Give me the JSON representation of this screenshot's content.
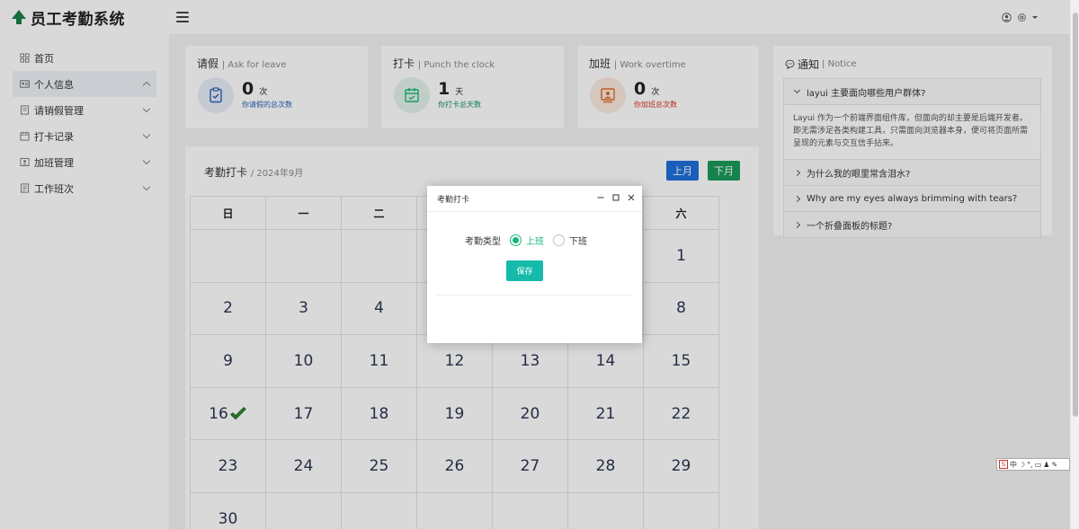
{
  "app": {
    "title": "员工考勤系统"
  },
  "header": {
    "user_icon": "user-icon",
    "settings_icon": "gear-icon"
  },
  "sidebar": {
    "items": [
      {
        "label": "首页",
        "icon": "grid-icon",
        "has_arrow": false
      },
      {
        "label": "个人信息",
        "icon": "id-card-icon",
        "has_arrow": true,
        "expanded": true
      },
      {
        "label": "请销假管理",
        "icon": "form-icon",
        "has_arrow": true
      },
      {
        "label": "打卡记录",
        "icon": "calendar-icon",
        "has_arrow": true
      },
      {
        "label": "加班管理",
        "icon": "monitor-icon",
        "has_arrow": true
      },
      {
        "label": "工作班次",
        "icon": "document-icon",
        "has_arrow": true
      }
    ]
  },
  "stats": [
    {
      "title": "请假",
      "subtitle": "| Ask for leave",
      "value": "0",
      "unit": "次",
      "desc": "你请假的总次数",
      "color": "#2d5fb3",
      "bg": "#e8edf7"
    },
    {
      "title": "打卡",
      "subtitle": "| Punch the clock",
      "value": "1",
      "unit": "天",
      "desc": "你打卡总天数",
      "color": "#16b777",
      "bg": "#e3f3ec"
    },
    {
      "title": "加班",
      "subtitle": "| Work overtime",
      "value": "0",
      "unit": "次",
      "desc": "你加班总次数",
      "color": "#e06a2f",
      "bg": "#fbeadf"
    }
  ],
  "calendar": {
    "title": "考勤打卡",
    "subtitle": "/ 2024年9月",
    "prev_label": "上月",
    "next_label": "下月",
    "weekdays": [
      "日",
      "一",
      "二",
      "三",
      "四",
      "五",
      "六"
    ],
    "weeks": [
      [
        "",
        "",
        "",
        "",
        "",
        "",
        "1"
      ],
      [
        "2",
        "3",
        "4",
        "5",
        "6",
        "7",
        "8"
      ],
      [
        "9",
        "10",
        "11",
        "12",
        "13",
        "14",
        "15"
      ],
      [
        "16",
        "17",
        "18",
        "19",
        "20",
        "21",
        "22"
      ],
      [
        "23",
        "24",
        "25",
        "26",
        "27",
        "28",
        "29"
      ],
      [
        "30",
        "",
        "",
        "",
        "",
        "",
        ""
      ]
    ],
    "checked_day": "16"
  },
  "notice": {
    "title": "通知",
    "subtitle": "| Notice",
    "items": [
      {
        "q": "layui 主要面向哪些用户群体?",
        "open": true,
        "a": "Layui 作为一个前端界面组件库，但面向的却主要是后端开发者。即无需涉足各类构建工具，只需面向浏览器本身，便可将页面所需呈现的元素与交互信手拈来。"
      },
      {
        "q": "为什么我的眼里常含泪水?",
        "open": false
      },
      {
        "q": "Why are my eyes always brimming with tears?",
        "open": false
      },
      {
        "q": "一个折叠面板的标题?",
        "open": false
      }
    ]
  },
  "modal": {
    "title": "考勤打卡",
    "field_label": "考勤类型",
    "options": [
      "上班",
      "下班"
    ],
    "selected": "上班",
    "save_label": "保存"
  },
  "ime": {
    "label": "中"
  }
}
